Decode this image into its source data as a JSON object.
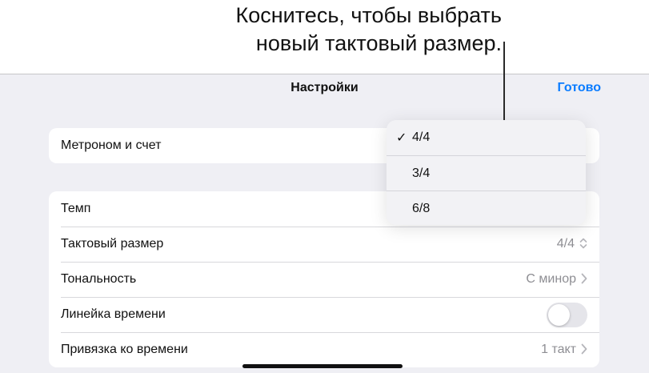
{
  "callout": {
    "line1": "Коснитесь, чтобы выбрать",
    "line2": "новый тактовый размер."
  },
  "header": {
    "title": "Настройки",
    "done_label": "Готово"
  },
  "groups": {
    "metronome": {
      "label": "Метроном и счет"
    },
    "settings": {
      "tempo": {
        "label": "Темп"
      },
      "time_signature": {
        "label": "Тактовый размер",
        "value": "4/4"
      },
      "key": {
        "label": "Тональность",
        "value": "C минор"
      },
      "ruler": {
        "label": "Линейка времени",
        "enabled": false
      },
      "snap": {
        "label": "Привязка ко времени",
        "value": "1 такт"
      }
    }
  },
  "popup": {
    "options": [
      "4/4",
      "3/4",
      "6/8"
    ],
    "selected": "4/4",
    "check_glyph": "✓"
  },
  "colors": {
    "accent": "#0a7cff",
    "panel_bg": "#efeff4"
  }
}
